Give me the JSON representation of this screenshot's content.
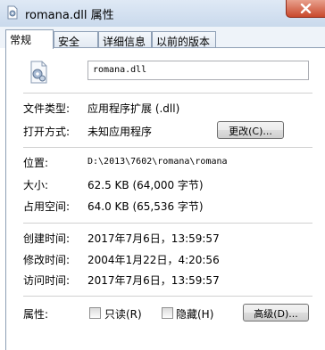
{
  "window": {
    "title": "romana.dll 属性",
    "file_icon": "dll-file-icon",
    "close_icon": "close-icon"
  },
  "tabs": [
    {
      "label": "常规",
      "active": true
    },
    {
      "label": "安全",
      "active": false
    },
    {
      "label": "详细信息",
      "active": false
    },
    {
      "label": "以前的版本",
      "active": false
    }
  ],
  "general": {
    "file_name": "romana.dll",
    "file_type_label": "文件类型:",
    "file_type_value": "应用程序扩展 (.dll)",
    "opens_with_label": "打开方式:",
    "opens_with_value": "未知应用程序",
    "change_button": "更改(C)...",
    "location_label": "位置:",
    "location_value": "D:\\2013\\7602\\romana\\romana",
    "size_label": "大小:",
    "size_value": "62.5 KB (64,000 字节)",
    "size_on_disk_label": "占用空间:",
    "size_on_disk_value": "64.0 KB (65,536 字节)",
    "created_label": "创建时间:",
    "created_value": "2017年7月6日，13:59:57",
    "modified_label": "修改时间:",
    "modified_value": "2004年1月22日，4:20:56",
    "accessed_label": "访问时间:",
    "accessed_value": "2017年7月6日，13:59:57",
    "attributes_label": "属性:",
    "readonly_label": "只读(R)",
    "readonly_checked": false,
    "hidden_label": "隐藏(H)",
    "hidden_checked": false,
    "advanced_button": "高级(D)..."
  },
  "colors": {
    "titlebar": "#c9d9ec",
    "close_button": "#c9492c",
    "tab_border": "#8e9fb5"
  }
}
